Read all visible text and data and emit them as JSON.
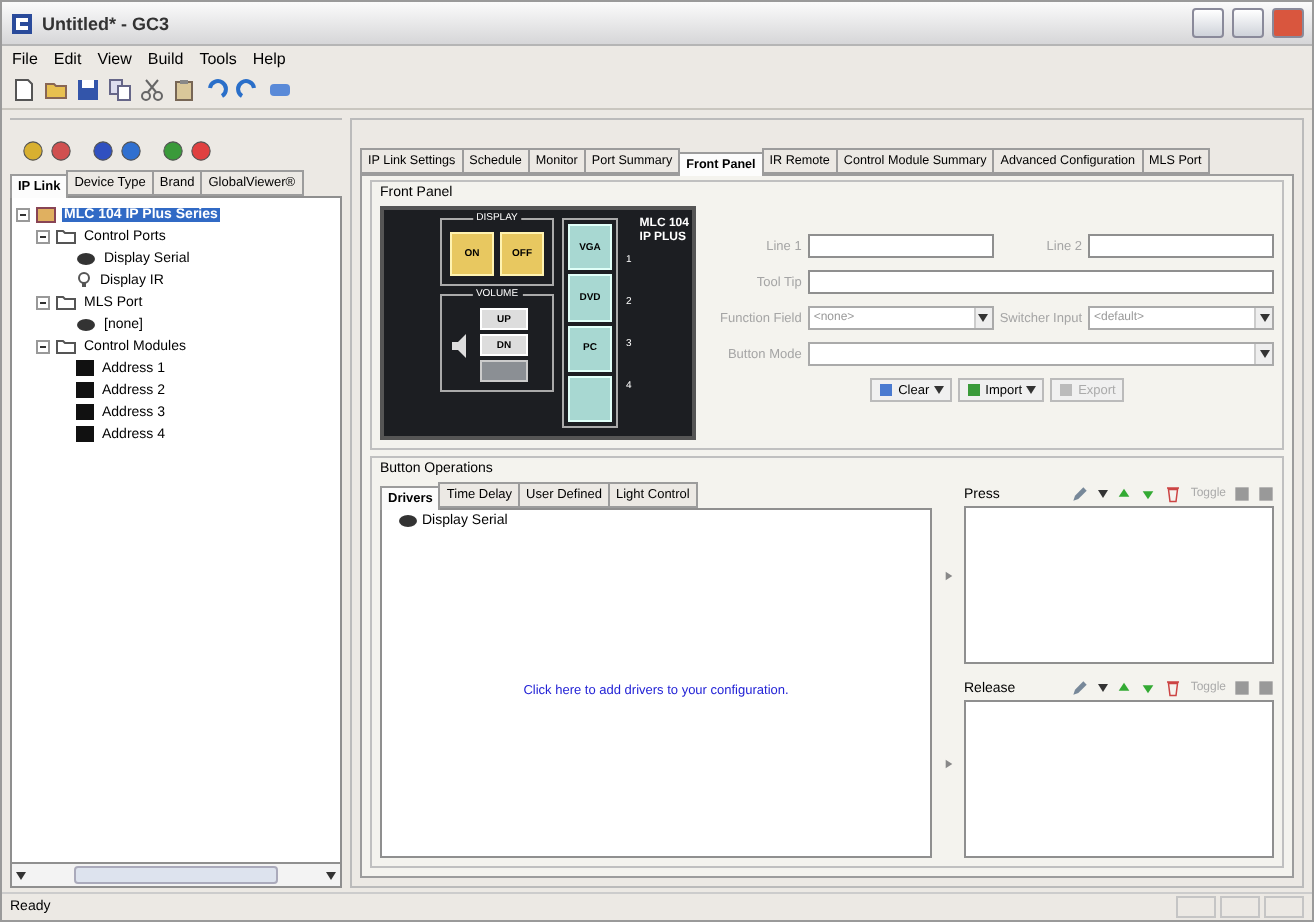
{
  "window": {
    "title": "Untitled* - GC3"
  },
  "menu": [
    "File",
    "Edit",
    "View",
    "Build",
    "Tools",
    "Help"
  ],
  "left_tabs": [
    {
      "label": "IP Link",
      "selected": true
    },
    {
      "label": "Device Type",
      "selected": false
    },
    {
      "label": "Brand",
      "selected": false
    },
    {
      "label": "GlobalViewer®",
      "selected": false
    }
  ],
  "tree": [
    {
      "label": "MLC 104 IP Plus Series",
      "kind": "device",
      "expanded": true,
      "selected": true,
      "children": [
        {
          "label": "Control Ports",
          "kind": "folder",
          "expanded": true,
          "selected": false,
          "children": [
            {
              "label": "Display Serial",
              "kind": "serial",
              "selected": false
            },
            {
              "label": "Display IR",
              "kind": "ir",
              "selected": false
            }
          ]
        },
        {
          "label": "MLS Port",
          "kind": "folder",
          "expanded": true,
          "selected": false,
          "children": [
            {
              "label": "[none]",
              "kind": "serial",
              "selected": false
            }
          ]
        },
        {
          "label": "Control Modules",
          "kind": "folder",
          "expanded": true,
          "selected": false,
          "children": [
            {
              "label": "Address 1",
              "kind": "module",
              "selected": false
            },
            {
              "label": "Address 2",
              "kind": "module",
              "selected": false
            },
            {
              "label": "Address 3",
              "kind": "module",
              "selected": false
            },
            {
              "label": "Address 4",
              "kind": "module",
              "selected": false
            }
          ]
        }
      ]
    }
  ],
  "right_tabs": [
    {
      "label": "IP Link Settings",
      "selected": false
    },
    {
      "label": "Schedule",
      "selected": false
    },
    {
      "label": "Monitor",
      "selected": false
    },
    {
      "label": "Port Summary",
      "selected": false
    },
    {
      "label": "Front Panel",
      "selected": true
    },
    {
      "label": "IR Remote",
      "selected": false
    },
    {
      "label": "Control Module Summary",
      "selected": false
    },
    {
      "label": "Advanced Configuration",
      "selected": false
    },
    {
      "label": "MLS Port",
      "selected": false
    }
  ],
  "front_panel": {
    "title": "Front Panel",
    "device": {
      "model": "MLC 104",
      "model_line2": "IP PLUS",
      "display_label": "DISPLAY",
      "display_keys": [
        "ON",
        "OFF"
      ],
      "volume_label": "VOLUME",
      "volume_keys": [
        "UP",
        "DN"
      ],
      "input_keys": [
        {
          "label": "VGA",
          "number": "1"
        },
        {
          "label": "DVD",
          "number": "2"
        },
        {
          "label": "PC",
          "number": "3"
        },
        {
          "number": "4"
        }
      ]
    },
    "disabled": true,
    "line1": {
      "label": "Line 1"
    },
    "line2": {
      "label": "Line 2"
    },
    "tool_tip": {
      "label": "Tool Tip"
    },
    "function_field": {
      "label": "Function Field",
      "value": "<none>"
    },
    "switcher_input": {
      "label": "Switcher Input",
      "value": "<default>"
    },
    "button_mode": {
      "label": "Button Mode"
    },
    "buttons": [
      {
        "label": "Clear",
        "dropdown": true,
        "disabled": false
      },
      {
        "label": "Import",
        "dropdown": true,
        "disabled": false
      },
      {
        "label": "Export",
        "dropdown": false,
        "disabled": true
      }
    ]
  },
  "button_operations": {
    "title": "Button Operations",
    "tabs": [
      {
        "label": "Drivers",
        "selected": true
      },
      {
        "label": "Time Delay",
        "selected": false
      },
      {
        "label": "User Defined",
        "selected": false
      },
      {
        "label": "Light Control",
        "selected": false
      }
    ],
    "items": [
      "Display Serial"
    ],
    "link": "Click here to add drivers to your configuration.",
    "lists": [
      {
        "title": "Press",
        "toggle": "Toggle"
      },
      {
        "title": "Release",
        "toggle": "Toggle"
      }
    ]
  },
  "status_bar": {
    "text": "Ready"
  }
}
